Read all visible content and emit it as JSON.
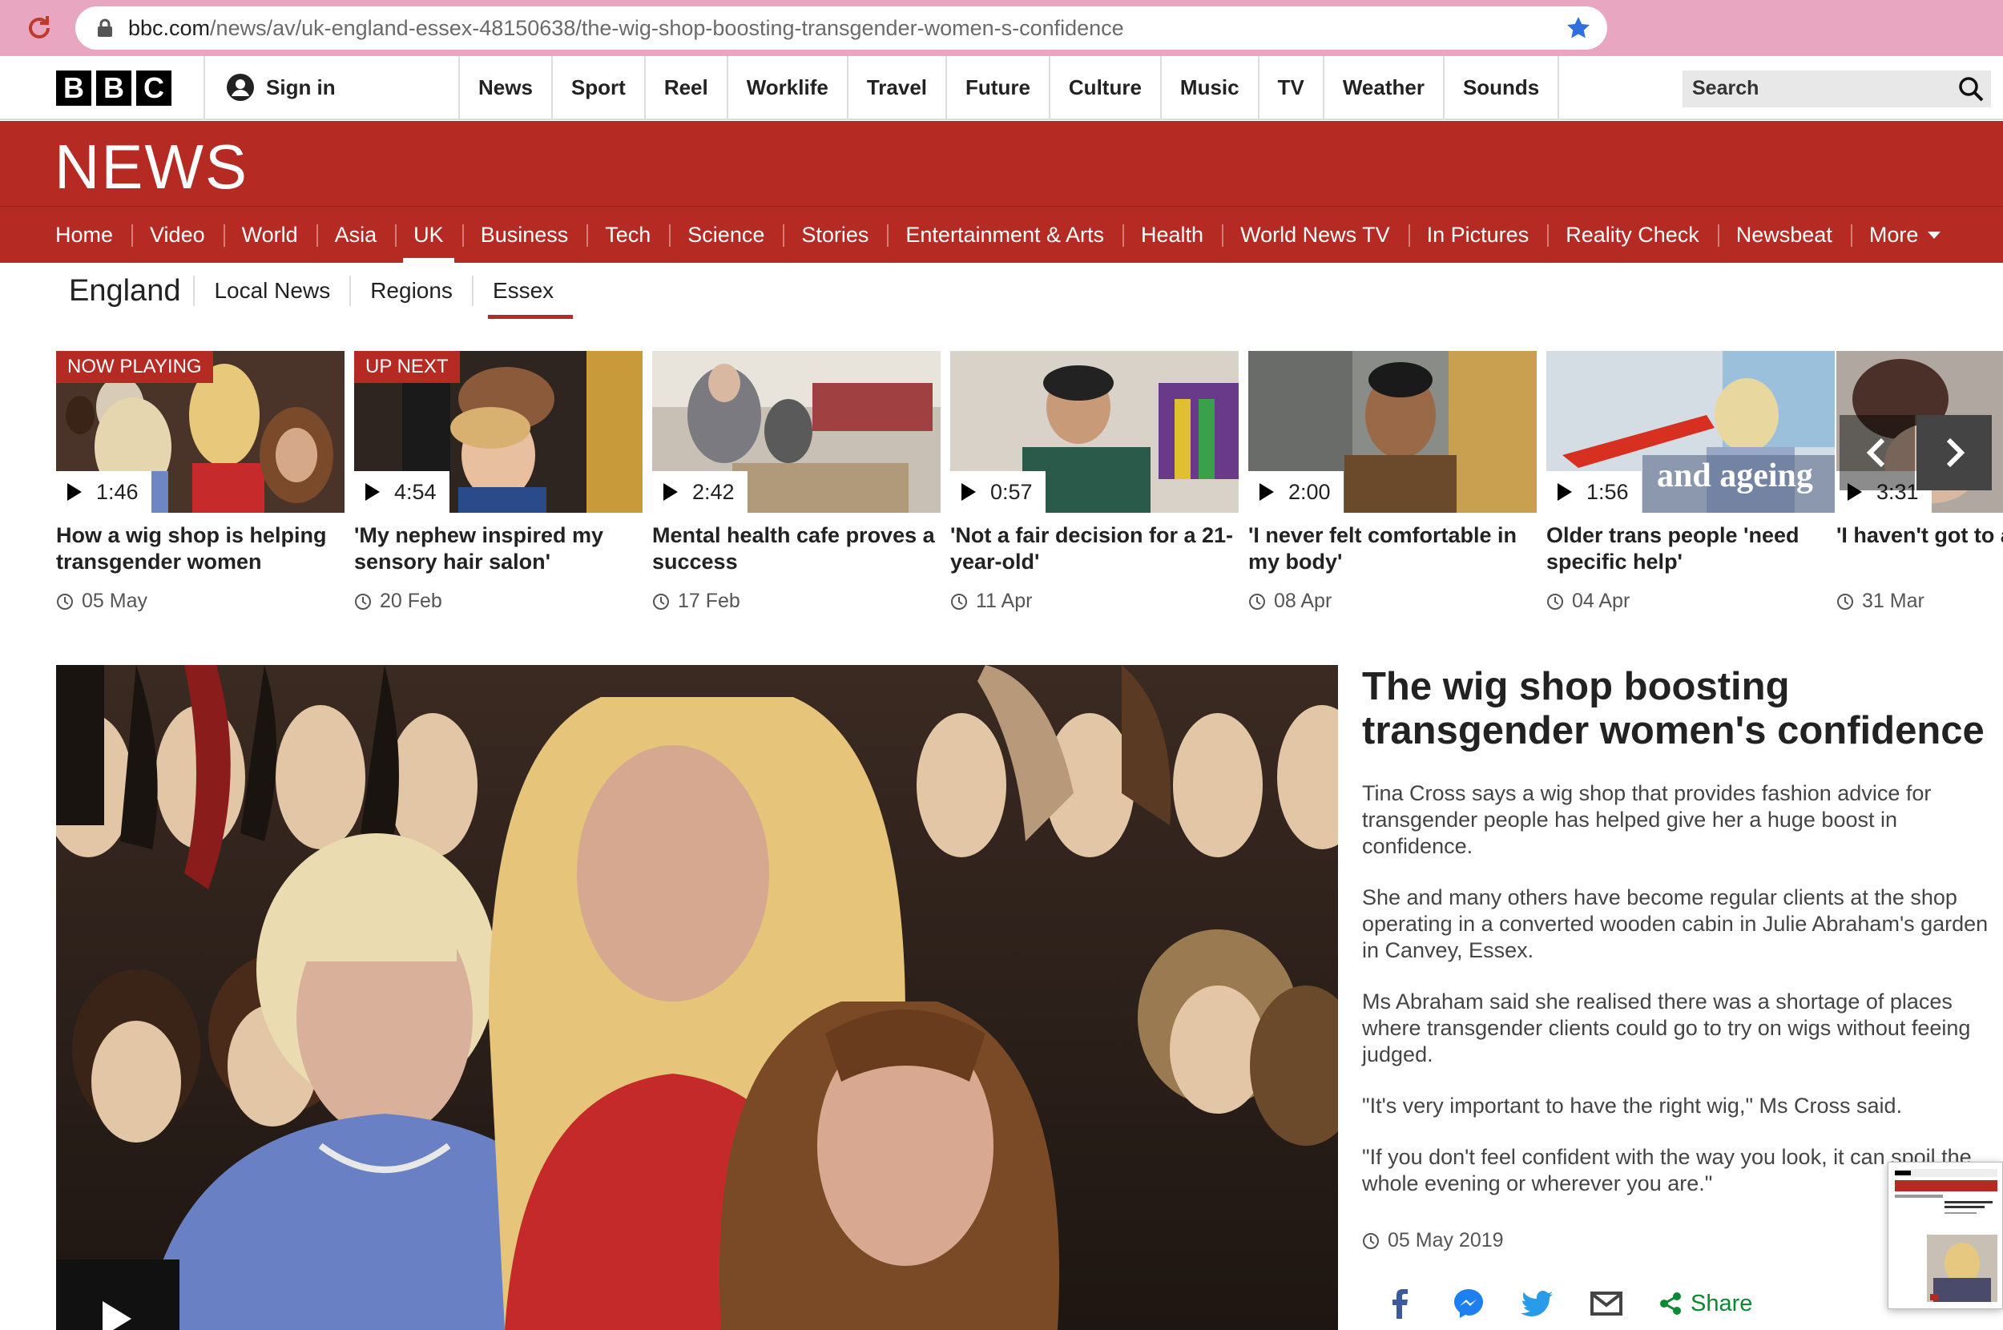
{
  "browser": {
    "url_host": "bbc.com",
    "url_path": "/news/av/uk-england-essex-48150638/the-wig-shop-boosting-transgender-women-s-confidence"
  },
  "topbar": {
    "logo_letters": [
      "B",
      "B",
      "C"
    ],
    "sign_in": "Sign in",
    "nav": [
      "News",
      "Sport",
      "Reel",
      "Worklife",
      "Travel",
      "Future",
      "Culture",
      "Music",
      "TV",
      "Weather",
      "Sounds"
    ],
    "search_placeholder": "Search"
  },
  "news": {
    "logo": "NEWS",
    "nav": [
      "Home",
      "Video",
      "World",
      "Asia",
      "UK",
      "Business",
      "Tech",
      "Science",
      "Stories",
      "Entertainment & Arts",
      "Health",
      "World News TV",
      "In Pictures",
      "Reality Check",
      "Newsbeat",
      "More"
    ],
    "active": "UK"
  },
  "subnav": {
    "section": "England",
    "items": [
      "Local News",
      "Regions",
      "Essex"
    ],
    "active": "Essex"
  },
  "videos": [
    {
      "tag": "NOW PLAYING",
      "duration": "1:46",
      "title": "How a wig shop is helping transgender women",
      "date": "05 May"
    },
    {
      "tag": "UP NEXT",
      "duration": "4:54",
      "title": "'My nephew inspired my sensory hair salon'",
      "date": "20 Feb"
    },
    {
      "tag": "",
      "duration": "2:42",
      "title": "Mental health cafe proves a success",
      "date": "17 Feb"
    },
    {
      "tag": "",
      "duration": "0:57",
      "title": "'Not a fair decision for a 21-year-old'",
      "date": "11 Apr"
    },
    {
      "tag": "",
      "duration": "2:00",
      "title": "'I never felt comfortable in my body'",
      "date": "08 Apr"
    },
    {
      "tag": "",
      "duration": "1:56",
      "title": "Older trans people 'need specific help'",
      "date": "04 Apr"
    },
    {
      "tag": "",
      "duration": "3:31",
      "title": "'I haven't got to anyone'",
      "date": "31 Mar"
    }
  ],
  "thumb_overlay_text": "and ageing",
  "article": {
    "headline": "The wig shop boosting transgender women's confidence",
    "paragraphs": [
      "Tina Cross says a wig shop that provides fashion advice for transgender people has helped give her a huge boost in confidence.",
      "She and many others have become regular clients at the shop operating in a converted wooden cabin in Julie Abraham's garden in Canvey, Essex.",
      "Ms Abraham said she realised there was a shortage of places where transgender clients could go to try on wigs without feeing judged.",
      "\"It's very important to have the right wig,\" Ms Cross said.",
      "\"If you don't feel confident with the way you look, it can spoil the whole evening or wherever you are.\""
    ],
    "date": "05 May 2019",
    "share_label": "Share"
  },
  "colors": {
    "bbc_red": "#b52a23",
    "share_green": "#0a8a32",
    "browser_bar": "#e8a6c0"
  }
}
